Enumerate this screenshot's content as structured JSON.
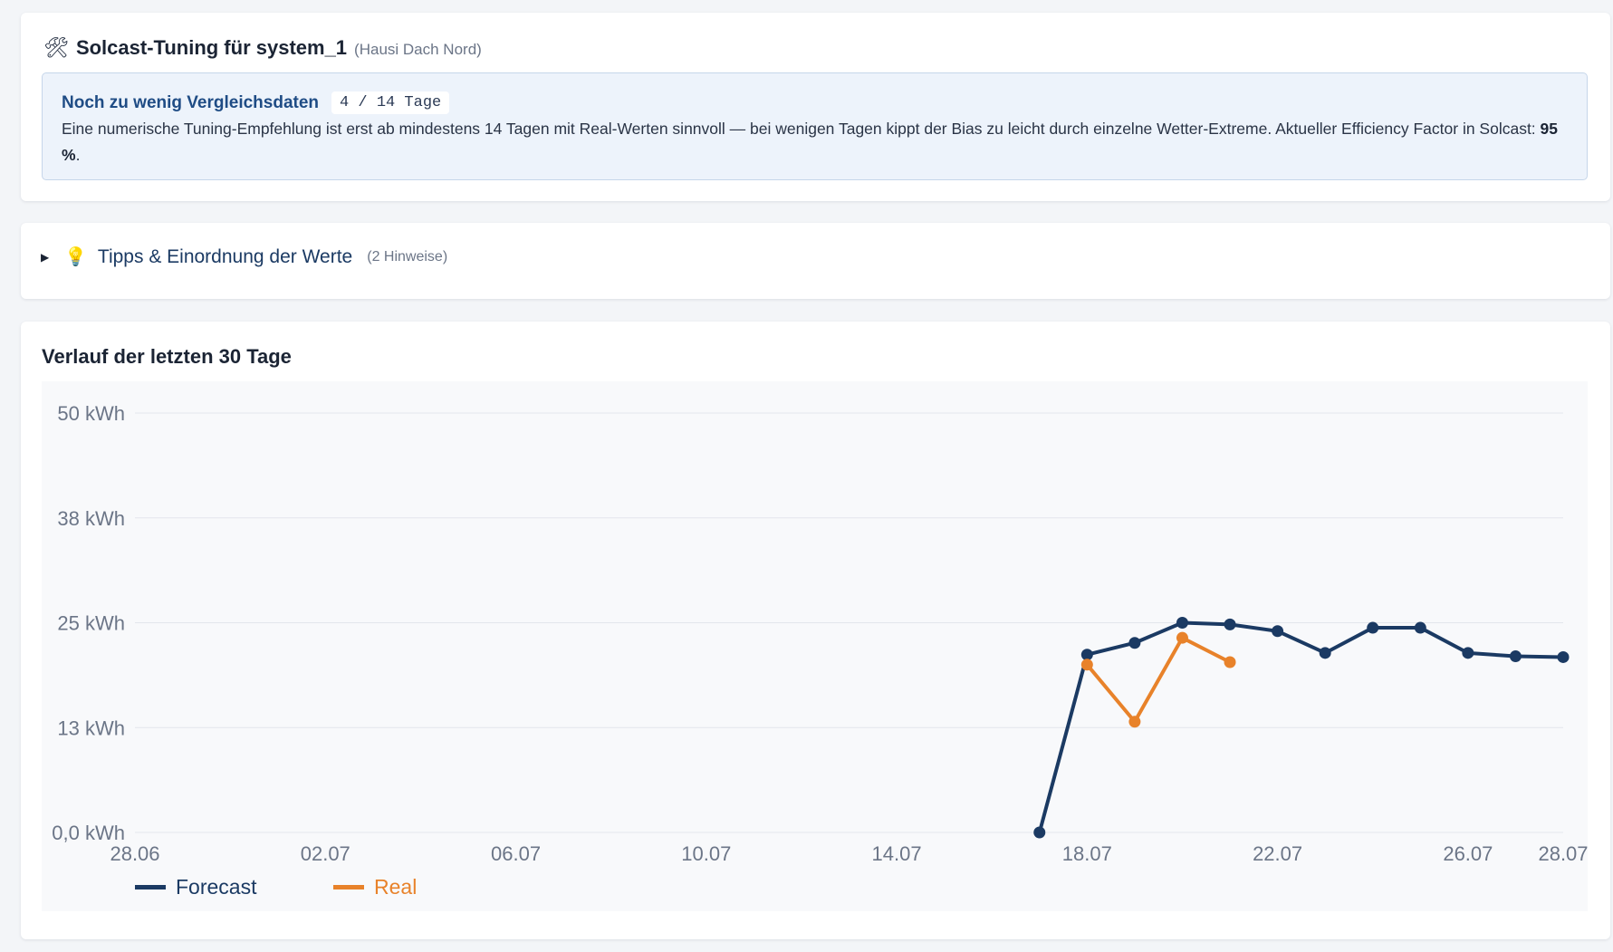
{
  "tuning": {
    "icon": "tools-icon",
    "title": "Solcast-Tuning für system_1",
    "subtitle": "(Hausi Dach Nord)",
    "notice": {
      "heading": "Noch zu wenig Vergleichsdaten",
      "badge": "4 / 14 Tage",
      "text_before": "Eine numerische Tuning-Empfehlung ist erst ab mindestens 14 Tagen mit Real-Werten sinnvoll — bei wenigen Tagen kippt der Bias zu leicht durch einzelne Wetter-Extreme. Aktueller Efficiency Factor in Solcast: ",
      "efficiency": "95 %",
      "text_after": "."
    }
  },
  "tips": {
    "arrow": "▶",
    "icon": "lightbulb-icon",
    "label": "Tipps & Einordnung der Werte",
    "count": "(2 Hinweise)"
  },
  "chart": {
    "title": "Verlauf der letzten 30 Tage"
  },
  "colors": {
    "forecast": "#1b3a63",
    "real": "#e8822a",
    "grid": "#e3e6ec"
  },
  "chart_data": {
    "type": "line",
    "title": "Verlauf der letzten 30 Tage",
    "y_ticks": [
      "50 kWh",
      "38 kWh",
      "25 kWh",
      "13 kWh",
      "0,0 kWh"
    ],
    "y_tick_values": [
      50,
      37.5,
      25,
      12.5,
      0
    ],
    "ylim": [
      0,
      50
    ],
    "x_ticks": [
      "28.06",
      "02.07",
      "06.07",
      "10.07",
      "14.07",
      "18.07",
      "22.07",
      "26.07",
      "28.07"
    ],
    "x_tick_days": [
      0,
      4,
      8,
      12,
      16,
      20,
      24,
      28,
      30
    ],
    "xlim": [
      "28.06",
      "28.07"
    ],
    "grid": true,
    "legend": "bottom-left",
    "series": [
      {
        "name": "Forecast",
        "color": "#1b3a63",
        "x": [
          "17.07",
          "18.07",
          "19.07",
          "20.07",
          "21.07",
          "22.07",
          "23.07",
          "24.07",
          "25.07",
          "26.07",
          "27.07",
          "28.07"
        ],
        "y": [
          0,
          21.2,
          22.6,
          25.0,
          24.8,
          24.0,
          21.4,
          24.4,
          24.4,
          21.4,
          21.0,
          20.9
        ]
      },
      {
        "name": "Real",
        "color": "#e8822a",
        "x": [
          "18.07",
          "19.07",
          "20.07",
          "21.07"
        ],
        "y": [
          20.0,
          13.2,
          23.2,
          20.3
        ]
      }
    ]
  }
}
